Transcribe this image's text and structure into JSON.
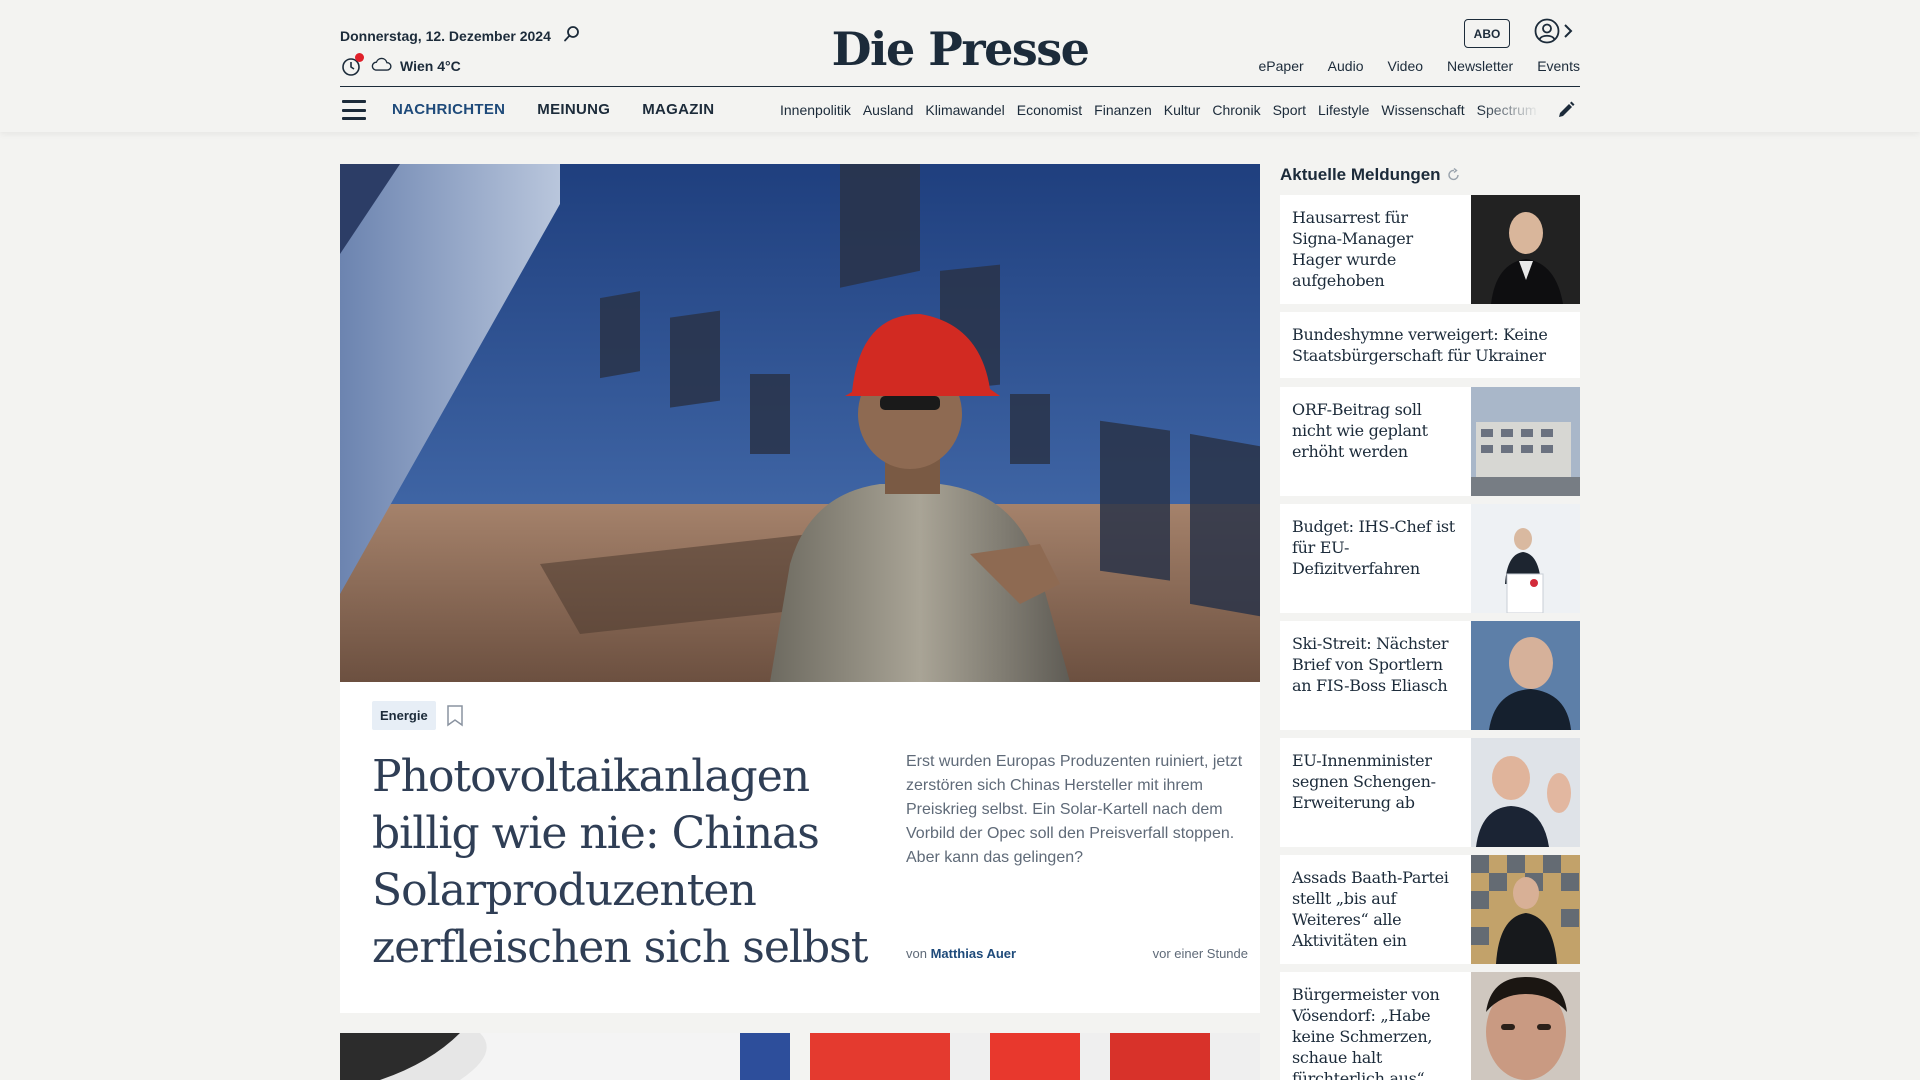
{
  "header": {
    "date": "Donnerstag, 12. Dezember 2024",
    "weather": "Wien 4°C",
    "logo": "Die Presse",
    "abo_label": "ABO",
    "top_links": [
      "ePaper",
      "Audio",
      "Video",
      "Newsletter",
      "Events"
    ],
    "main_nav": [
      "NACHRICHTEN",
      "MEINUNG",
      "MAGAZIN"
    ],
    "sub_nav": [
      "Innenpolitik",
      "Ausland",
      "Klimawandel",
      "Economist",
      "Finanzen",
      "Kultur",
      "Chronik",
      "Sport",
      "Lifestyle",
      "Wissenschaft",
      "Spectrum"
    ]
  },
  "hero": {
    "tag": "Energie",
    "title": "Photovoltaikanlagen billig wie nie: Chinas Solarproduzenten zerfleischen sich selbst",
    "lead": "Erst wurden Europas Produzenten ruiniert, jetzt zerstören sich Chinas Hersteller mit ihrem Preiskrieg selbst. Ein Solar-Kartell nach dem Vorbild der Opec soll den Preisverfall stoppen. Aber kann das gelingen?",
    "author_prefix": "von",
    "author": "Matthias Auer",
    "time": "vor einer Stunde"
  },
  "sidebar": {
    "heading": "Aktuelle Meldungen",
    "items": [
      {
        "title": "Hausarrest für Signa-Manager Hager wurde aufgehoben",
        "thumb": "portrait-suit"
      },
      {
        "title": "Bundeshymne verweigert: Keine Staatsbürgerschaft für Ukrainer",
        "thumb": ""
      },
      {
        "title": "ORF-Beitrag soll nicht wie geplant erhöht werden",
        "thumb": "building"
      },
      {
        "title": "Budget: IHS-Chef ist für EU-Defizitverfahren",
        "thumb": "speaker-podium"
      },
      {
        "title": "Ski-Streit: Nächster Brief von Sportlern an FIS-Boss Eliasch",
        "thumb": "portrait-bald"
      },
      {
        "title": "EU-Innenminister segnen Schengen-Erweiterung ab",
        "thumb": "portrait-gesture"
      },
      {
        "title": "Assads Baath-Partei stellt „bis auf Weiteres“ alle Aktivitäten ein",
        "thumb": "portrait-mosaic"
      },
      {
        "title": "Bürgermeister von Vösendorf: „Habe keine Schmerzen, schaue halt fürchterlich aus“",
        "thumb": "portrait-closeup"
      }
    ]
  },
  "colors": {
    "background": "#f3f3f1",
    "ink": "#1c2b3a",
    "accent": "#1e4a7a",
    "tag_bg": "#e7eef6",
    "alert_dot": "#e0202a"
  }
}
